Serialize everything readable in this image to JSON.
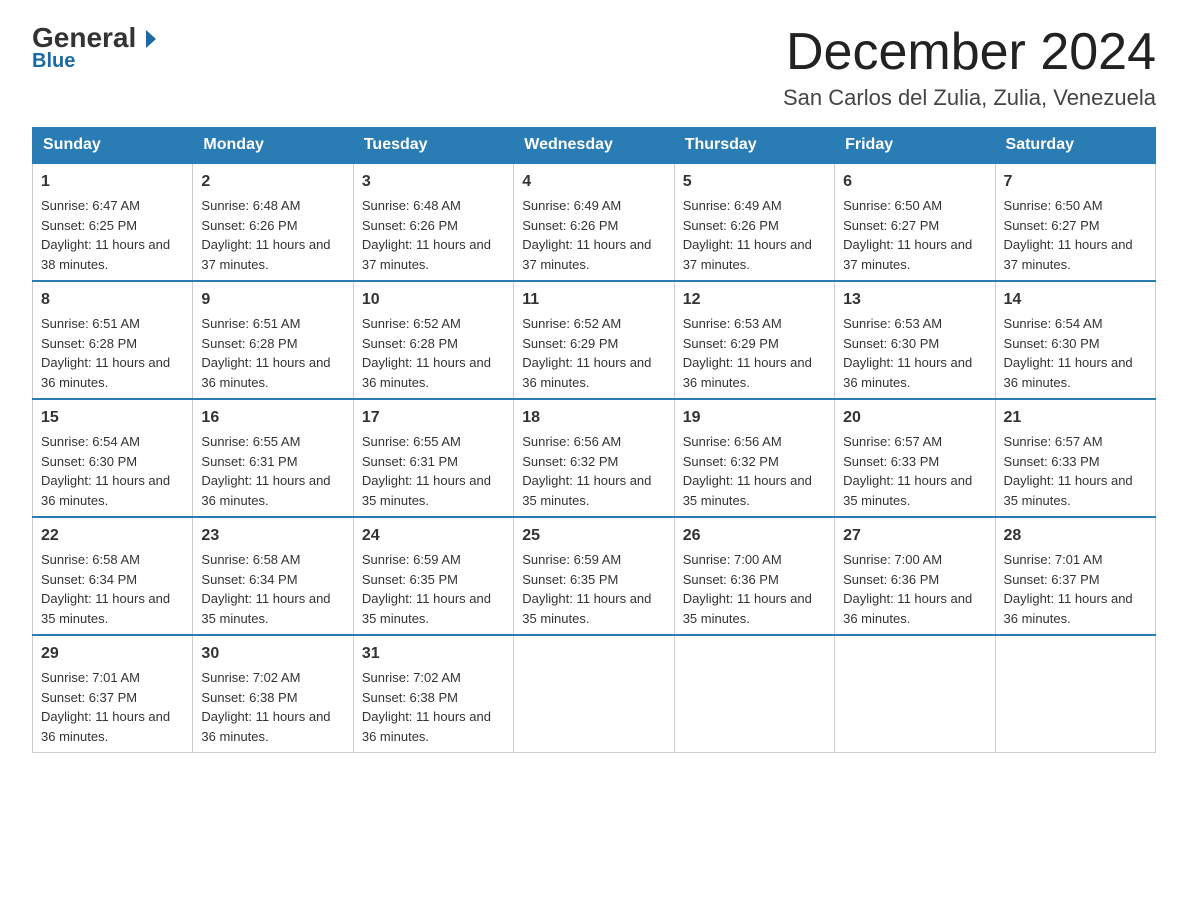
{
  "logo": {
    "general": "General",
    "blue": "Blue"
  },
  "title": "December 2024",
  "subtitle": "San Carlos del Zulia, Zulia, Venezuela",
  "days_of_week": [
    "Sunday",
    "Monday",
    "Tuesday",
    "Wednesday",
    "Thursday",
    "Friday",
    "Saturday"
  ],
  "weeks": [
    [
      {
        "day": "1",
        "sunrise": "Sunrise: 6:47 AM",
        "sunset": "Sunset: 6:25 PM",
        "daylight": "Daylight: 11 hours and 38 minutes."
      },
      {
        "day": "2",
        "sunrise": "Sunrise: 6:48 AM",
        "sunset": "Sunset: 6:26 PM",
        "daylight": "Daylight: 11 hours and 37 minutes."
      },
      {
        "day": "3",
        "sunrise": "Sunrise: 6:48 AM",
        "sunset": "Sunset: 6:26 PM",
        "daylight": "Daylight: 11 hours and 37 minutes."
      },
      {
        "day": "4",
        "sunrise": "Sunrise: 6:49 AM",
        "sunset": "Sunset: 6:26 PM",
        "daylight": "Daylight: 11 hours and 37 minutes."
      },
      {
        "day": "5",
        "sunrise": "Sunrise: 6:49 AM",
        "sunset": "Sunset: 6:26 PM",
        "daylight": "Daylight: 11 hours and 37 minutes."
      },
      {
        "day": "6",
        "sunrise": "Sunrise: 6:50 AM",
        "sunset": "Sunset: 6:27 PM",
        "daylight": "Daylight: 11 hours and 37 minutes."
      },
      {
        "day": "7",
        "sunrise": "Sunrise: 6:50 AM",
        "sunset": "Sunset: 6:27 PM",
        "daylight": "Daylight: 11 hours and 37 minutes."
      }
    ],
    [
      {
        "day": "8",
        "sunrise": "Sunrise: 6:51 AM",
        "sunset": "Sunset: 6:28 PM",
        "daylight": "Daylight: 11 hours and 36 minutes."
      },
      {
        "day": "9",
        "sunrise": "Sunrise: 6:51 AM",
        "sunset": "Sunset: 6:28 PM",
        "daylight": "Daylight: 11 hours and 36 minutes."
      },
      {
        "day": "10",
        "sunrise": "Sunrise: 6:52 AM",
        "sunset": "Sunset: 6:28 PM",
        "daylight": "Daylight: 11 hours and 36 minutes."
      },
      {
        "day": "11",
        "sunrise": "Sunrise: 6:52 AM",
        "sunset": "Sunset: 6:29 PM",
        "daylight": "Daylight: 11 hours and 36 minutes."
      },
      {
        "day": "12",
        "sunrise": "Sunrise: 6:53 AM",
        "sunset": "Sunset: 6:29 PM",
        "daylight": "Daylight: 11 hours and 36 minutes."
      },
      {
        "day": "13",
        "sunrise": "Sunrise: 6:53 AM",
        "sunset": "Sunset: 6:30 PM",
        "daylight": "Daylight: 11 hours and 36 minutes."
      },
      {
        "day": "14",
        "sunrise": "Sunrise: 6:54 AM",
        "sunset": "Sunset: 6:30 PM",
        "daylight": "Daylight: 11 hours and 36 minutes."
      }
    ],
    [
      {
        "day": "15",
        "sunrise": "Sunrise: 6:54 AM",
        "sunset": "Sunset: 6:30 PM",
        "daylight": "Daylight: 11 hours and 36 minutes."
      },
      {
        "day": "16",
        "sunrise": "Sunrise: 6:55 AM",
        "sunset": "Sunset: 6:31 PM",
        "daylight": "Daylight: 11 hours and 36 minutes."
      },
      {
        "day": "17",
        "sunrise": "Sunrise: 6:55 AM",
        "sunset": "Sunset: 6:31 PM",
        "daylight": "Daylight: 11 hours and 35 minutes."
      },
      {
        "day": "18",
        "sunrise": "Sunrise: 6:56 AM",
        "sunset": "Sunset: 6:32 PM",
        "daylight": "Daylight: 11 hours and 35 minutes."
      },
      {
        "day": "19",
        "sunrise": "Sunrise: 6:56 AM",
        "sunset": "Sunset: 6:32 PM",
        "daylight": "Daylight: 11 hours and 35 minutes."
      },
      {
        "day": "20",
        "sunrise": "Sunrise: 6:57 AM",
        "sunset": "Sunset: 6:33 PM",
        "daylight": "Daylight: 11 hours and 35 minutes."
      },
      {
        "day": "21",
        "sunrise": "Sunrise: 6:57 AM",
        "sunset": "Sunset: 6:33 PM",
        "daylight": "Daylight: 11 hours and 35 minutes."
      }
    ],
    [
      {
        "day": "22",
        "sunrise": "Sunrise: 6:58 AM",
        "sunset": "Sunset: 6:34 PM",
        "daylight": "Daylight: 11 hours and 35 minutes."
      },
      {
        "day": "23",
        "sunrise": "Sunrise: 6:58 AM",
        "sunset": "Sunset: 6:34 PM",
        "daylight": "Daylight: 11 hours and 35 minutes."
      },
      {
        "day": "24",
        "sunrise": "Sunrise: 6:59 AM",
        "sunset": "Sunset: 6:35 PM",
        "daylight": "Daylight: 11 hours and 35 minutes."
      },
      {
        "day": "25",
        "sunrise": "Sunrise: 6:59 AM",
        "sunset": "Sunset: 6:35 PM",
        "daylight": "Daylight: 11 hours and 35 minutes."
      },
      {
        "day": "26",
        "sunrise": "Sunrise: 7:00 AM",
        "sunset": "Sunset: 6:36 PM",
        "daylight": "Daylight: 11 hours and 35 minutes."
      },
      {
        "day": "27",
        "sunrise": "Sunrise: 7:00 AM",
        "sunset": "Sunset: 6:36 PM",
        "daylight": "Daylight: 11 hours and 36 minutes."
      },
      {
        "day": "28",
        "sunrise": "Sunrise: 7:01 AM",
        "sunset": "Sunset: 6:37 PM",
        "daylight": "Daylight: 11 hours and 36 minutes."
      }
    ],
    [
      {
        "day": "29",
        "sunrise": "Sunrise: 7:01 AM",
        "sunset": "Sunset: 6:37 PM",
        "daylight": "Daylight: 11 hours and 36 minutes."
      },
      {
        "day": "30",
        "sunrise": "Sunrise: 7:02 AM",
        "sunset": "Sunset: 6:38 PM",
        "daylight": "Daylight: 11 hours and 36 minutes."
      },
      {
        "day": "31",
        "sunrise": "Sunrise: 7:02 AM",
        "sunset": "Sunset: 6:38 PM",
        "daylight": "Daylight: 11 hours and 36 minutes."
      },
      null,
      null,
      null,
      null
    ]
  ]
}
